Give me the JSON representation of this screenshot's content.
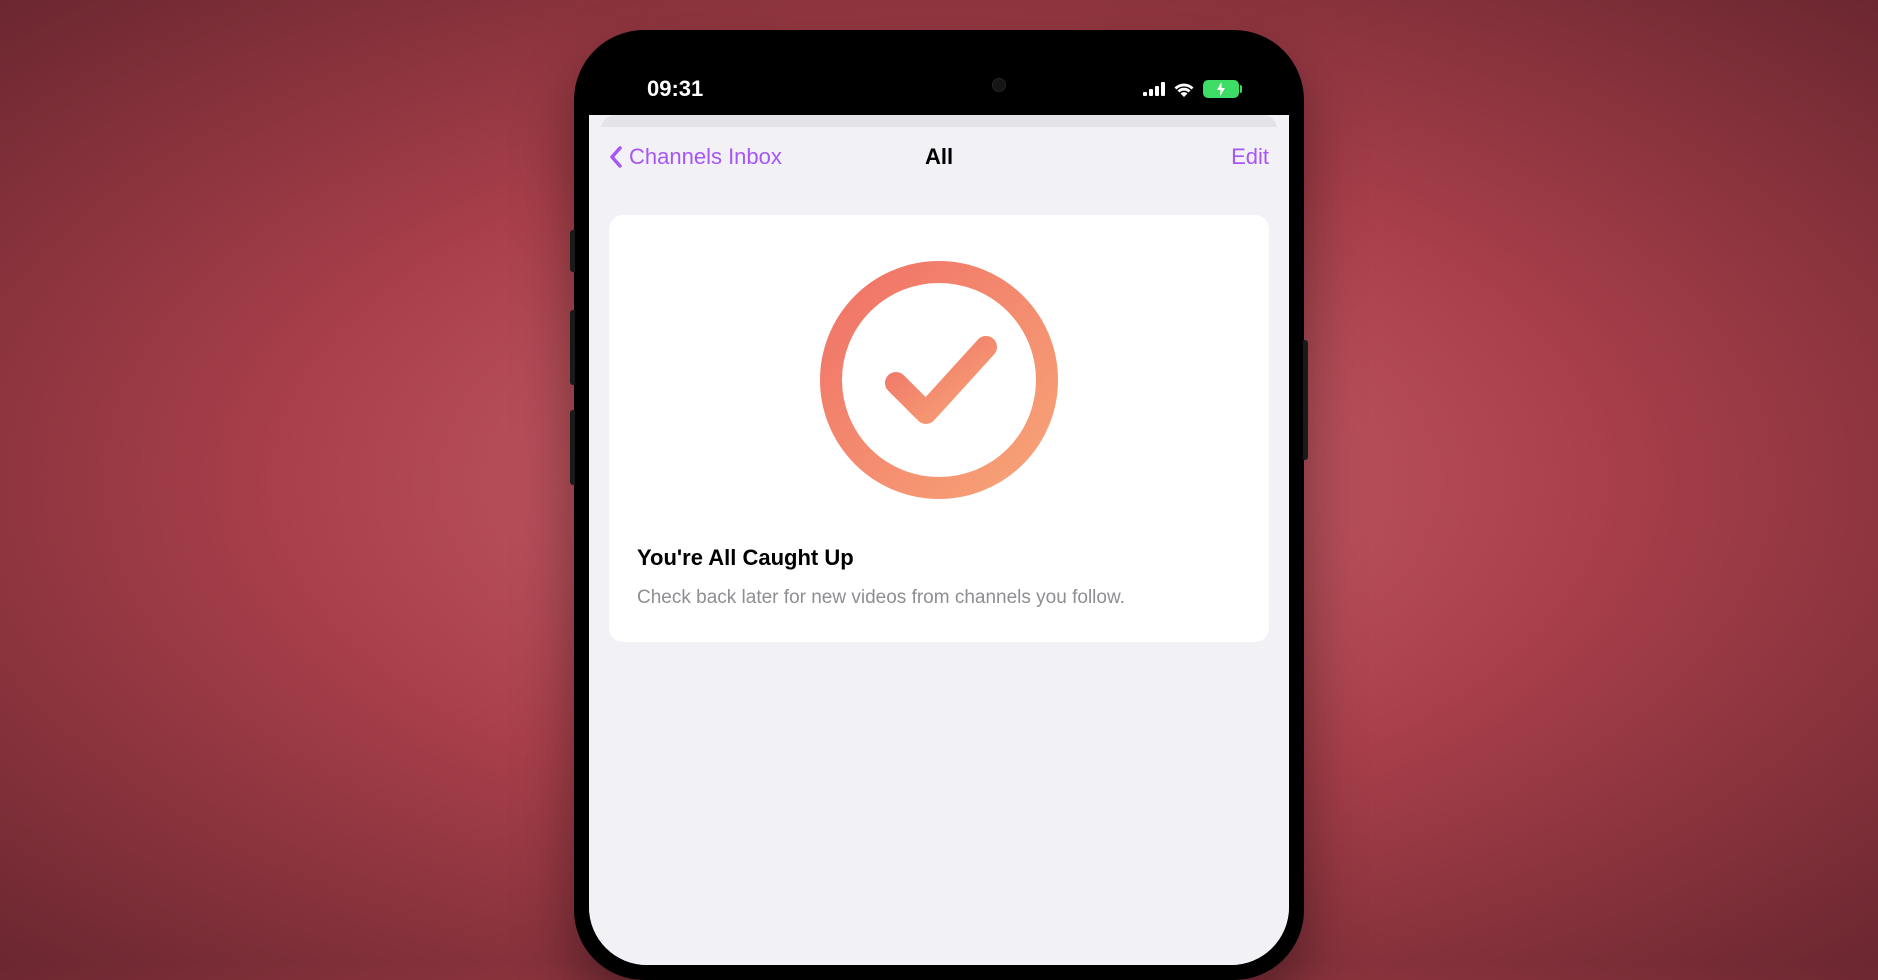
{
  "status_bar": {
    "time": "09:31"
  },
  "nav": {
    "back_label": "Channels Inbox",
    "title": "All",
    "edit_label": "Edit"
  },
  "empty_state": {
    "title": "You're All Caught Up",
    "subtitle": "Check back later for new videos from channels you follow."
  },
  "colors": {
    "accent": "#a855f7",
    "gradient_start": "#f07267",
    "gradient_end": "#f7a477"
  }
}
